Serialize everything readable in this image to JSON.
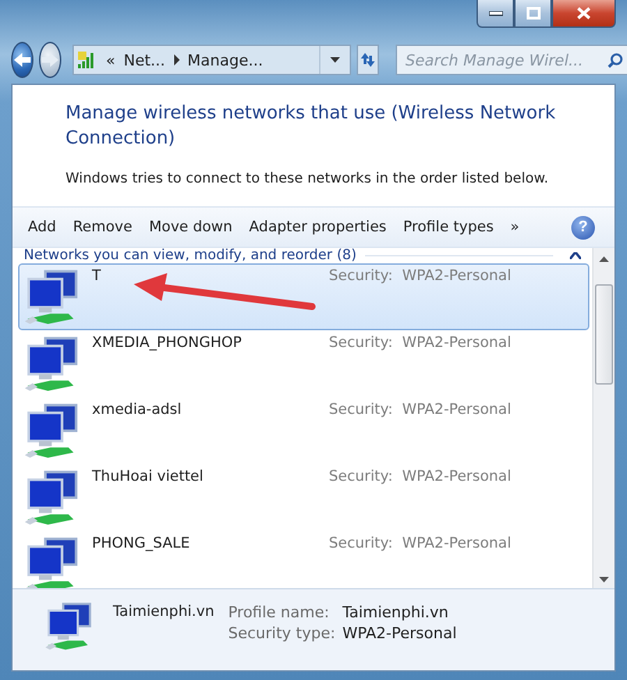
{
  "address_bar": {
    "overflow": "«",
    "crumbs": [
      "Net...",
      "Manage..."
    ]
  },
  "search": {
    "placeholder": "Search Manage Wirel..."
  },
  "heading": "Manage wireless networks that use (Wireless Network Connection)",
  "description": "Windows tries to connect to these networks in the order listed below.",
  "toolbar": {
    "items": [
      "Add",
      "Remove",
      "Move down",
      "Adapter properties",
      "Profile types"
    ],
    "more": "»",
    "help": "?"
  },
  "group": {
    "title": "Networks you can view, modify, and reorder (8)",
    "expanded": true
  },
  "networks": [
    {
      "name": "T",
      "security": "Security:  WPA2-Personal",
      "selected": true
    },
    {
      "name": "XMEDIA_PHONGHOP",
      "security": "Security:  WPA2-Personal",
      "selected": false
    },
    {
      "name": "xmedia-adsl",
      "security": "Security:  WPA2-Personal",
      "selected": false
    },
    {
      "name": "ThuHoai viettel",
      "security": "Security:  WPA2-Personal",
      "selected": false
    },
    {
      "name": "PHONG_SALE",
      "security": "Security:  WPA2-Personal",
      "selected": false
    }
  ],
  "details": {
    "name": "Taimienphi.vn",
    "fields": [
      {
        "label": "Profile name:",
        "value": "Taimienphi.vn"
      },
      {
        "label": "Security type:",
        "value": "WPA2-Personal"
      }
    ]
  },
  "annotation": {
    "kind": "arrow"
  }
}
